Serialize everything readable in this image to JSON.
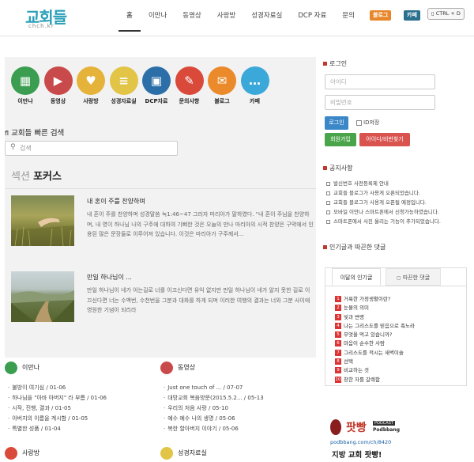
{
  "header": {
    "logo_text": "교회들",
    "logo_sub": "chch.kr",
    "nav": [
      "홈",
      "이만나",
      "동영상",
      "사랑방",
      "성경자료실",
      "DCP 자료",
      "문의"
    ],
    "badge_blog": "블로그",
    "badge_cafe": "카페",
    "shortcut": "CTRL + D"
  },
  "icons": [
    {
      "label": "이만나",
      "icon": "calendar-icon",
      "color": "#3a9d4f",
      "glyph": "▦"
    },
    {
      "label": "동영상",
      "icon": "video-icon",
      "color": "#c94a4a",
      "glyph": "▶"
    },
    {
      "label": "사랑방",
      "icon": "heart-icon",
      "color": "#e5b33a",
      "glyph": "♥"
    },
    {
      "label": "성경자료실",
      "icon": "book-icon",
      "color": "#e2c447",
      "glyph": "≡"
    },
    {
      "label": "DCP자료",
      "icon": "briefcase-icon",
      "color": "#2c6fa8",
      "glyph": "▣"
    },
    {
      "label": "문의사항",
      "icon": "pencil-icon",
      "color": "#d94a3a",
      "glyph": "✎"
    },
    {
      "label": "블로그",
      "icon": "chat-icon",
      "color": "#ea8a2a",
      "glyph": "✉"
    },
    {
      "label": "카페",
      "icon": "message-icon",
      "color": "#3aa8d8",
      "glyph": "…"
    }
  ],
  "quick_search": {
    "title": "교회들 빠른 검색",
    "placeholder": "검색"
  },
  "focus": {
    "head_a": "섹션",
    "head_b": "포커스",
    "posts": [
      {
        "title": "내 혼이 주를 찬양하며",
        "body": "내 혼이 주를 찬양하며 성경말씀 눅1:46~47 그러자 마리아가 말하였다. \"내 혼이 주님을 찬양하며, 내 영이 하나님 나의 구주에 대하여 기뻐한 것은 오늘의 만나 마리아의 시적 찬양은 구약에서 인용된 많은 문장들로 이루어져 있습니다. 이것은 마리아가 구주께서..."
      },
      {
        "title": "만일 하나님이 ...",
        "body": "만일 하나님이 네가 아는길로 너를 이끄신다면 유익 없지만 만일 하나님이 네가 알지 못한 길로 이끄신다면 너는 수백번, 수천번을 그분과 대화를 하게 되며 이러한 여행의 결과는 너와 그분 사이에 영원한 기념이 되리라"
      }
    ]
  },
  "login": {
    "title": "로그인",
    "id_placeholder": "아이디",
    "pw_placeholder": "비밀번호",
    "login_btn": "로그인",
    "save_id": "ID저장",
    "join_btn": "회원가입",
    "find_btn": "아이디/비번찾기"
  },
  "notice": {
    "title": "공지사항",
    "items": [
      "발신번호 사전등록제 안내",
      "교회들 블로그가 사용게 오픈되었습니다.",
      "교회들 블로그가 사용게 오픈될 예정입니다.",
      "모바일 이만나 스마트폰에서 신청가능하였습니다.",
      "스마트폰에서 사진 올리는 기능이 추가되었습니다."
    ]
  },
  "popular": {
    "title": "인기글과 따끈한 댓글",
    "tab1": "이달의 인기글",
    "tab2": "따끈한 댓글",
    "items": [
      "거룩한 가정생활이란?",
      "눈물의 의미",
      "빛과 변명",
      "나는 그리스도를 믿음으로 족노라",
      "무엇을 먹고 있습니까?",
      "마음이 순수한 사람",
      "그리스도를 적시는 새벽이슬",
      "선택",
      "비교하는 것",
      "창한 자를 갈렉함"
    ]
  },
  "bottom": {
    "manna": {
      "title": "이만나",
      "items": [
        "불방이 여기심 / 01-06",
        "하나님을 \"아바 아버지\" 라 부름 / 01-06",
        "시작, 진행, 결과 / 01-05",
        "아버지의 이름을 계시함 / 01-05",
        "특별한 성품 / 01-04"
      ]
    },
    "video": {
      "title": "동영상",
      "items": [
        "Just one touch of ... / 07-07",
        "대망교회 복음방문(2015.5.2... / 05-13",
        "우리의 처음 사랑 / 05-10",
        "예수 예수 나의 생명 / 05-06",
        "복한 할아버지 이야기 / 05-06"
      ]
    },
    "sarang": {
      "title": "사랑방"
    },
    "bible": {
      "title": "성경자료실"
    }
  },
  "ad": {
    "brand": "팟빵",
    "podcast": "PODCAST",
    "brand_en": "Podbbang",
    "url": "podbbang.com/ch/8420",
    "tagline": "지방 교회 팟빵!"
  }
}
